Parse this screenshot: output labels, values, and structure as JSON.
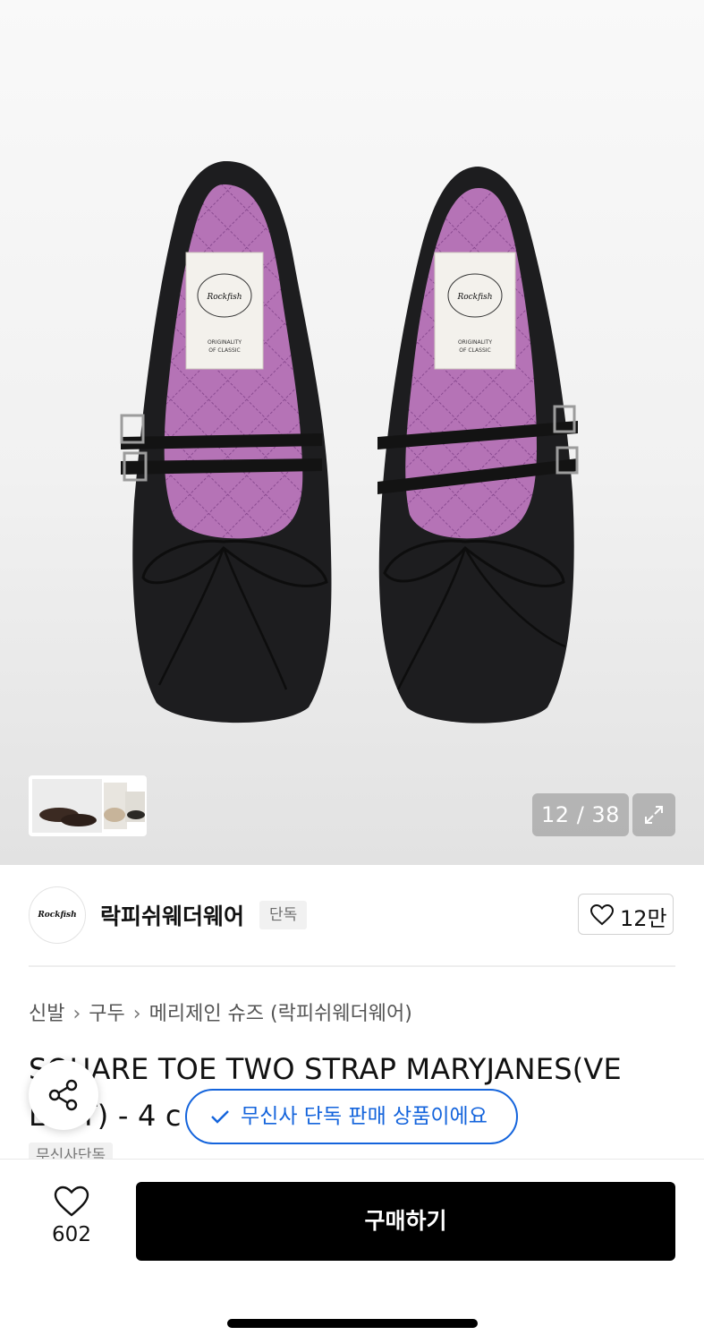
{
  "gallery": {
    "counter": "12 / 38"
  },
  "brand": {
    "name": "락피쉬웨더웨어",
    "badge": "단독",
    "logo_text": "Rockfish",
    "likes": "12만"
  },
  "breadcrumb": [
    "신발",
    "구두",
    "메리제인 슈즈 (락피쉬웨더웨어)"
  ],
  "product": {
    "title_line1": "SQUARE TOE TWO STRAP MARYJANES(VE",
    "title_line2": "LVET) - 4 c",
    "tag": "무신사단독"
  },
  "toast": {
    "message": "무신사 단독 판매 상품이에요"
  },
  "bottom": {
    "wish_count": "602",
    "buy_label": "구매하기"
  },
  "colors": {
    "accent_blue": "#1464dc",
    "buy_button": "#000000",
    "insole": "#b06fb3"
  }
}
